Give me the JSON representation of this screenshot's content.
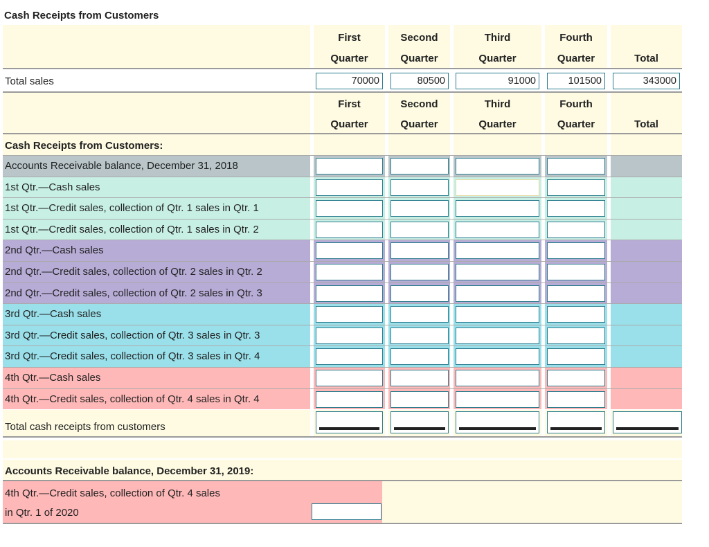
{
  "title": "Cash Receipts from Customers",
  "colors": {
    "cream": "#fefbe2",
    "gray": "#b9c5c9",
    "mint": "#c7efe4",
    "lavender": "#b7acd6",
    "cyan": "#9ae0ea",
    "pink": "#ffb8b8",
    "border": "#2b7c8e"
  },
  "headers": {
    "q1": [
      "First",
      "Quarter"
    ],
    "q2": [
      "Second",
      "Quarter"
    ],
    "q3": [
      "Third",
      "Quarter"
    ],
    "q4": [
      "Fourth",
      "Quarter"
    ],
    "total": "Total"
  },
  "total_sales": {
    "label": "Total sales",
    "values": [
      "70000",
      "80500",
      "91000",
      "101500",
      "343000"
    ]
  },
  "section_label": "Cash Receipts from Customers:",
  "rows": [
    "Accounts Receivable balance, December 31, 2018",
    "1st Qtr.—Cash sales",
    "1st Qtr.—Credit sales, collection of Qtr. 1 sales in Qtr. 1",
    "1st Qtr.—Credit sales, collection of Qtr. 1 sales in Qtr. 2",
    "2nd Qtr.—Cash sales",
    "2nd Qtr.—Credit sales, collection of Qtr. 2 sales in Qtr. 2",
    "2nd Qtr.—Credit sales, collection of Qtr. 2 sales in Qtr. 3",
    "3rd Qtr.—Cash sales",
    "3rd Qtr.—Credit sales, collection of Qtr. 3 sales in Qtr. 3",
    "3rd Qtr.—Credit sales, collection of Qtr. 3 sales in Qtr. 4",
    "4th Qtr.—Cash sales",
    "4th Qtr.—Credit sales, collection of Qtr. 4 sales in Qtr. 4"
  ],
  "total_receipts_label": "Total cash receipts from customers",
  "ar_2019": {
    "heading": "Accounts Receivable balance, December 31, 2019:",
    "line1": "4th Qtr.—Credit sales, collection of Qtr. 4 sales",
    "line2": "in Qtr. 1 of 2020"
  }
}
